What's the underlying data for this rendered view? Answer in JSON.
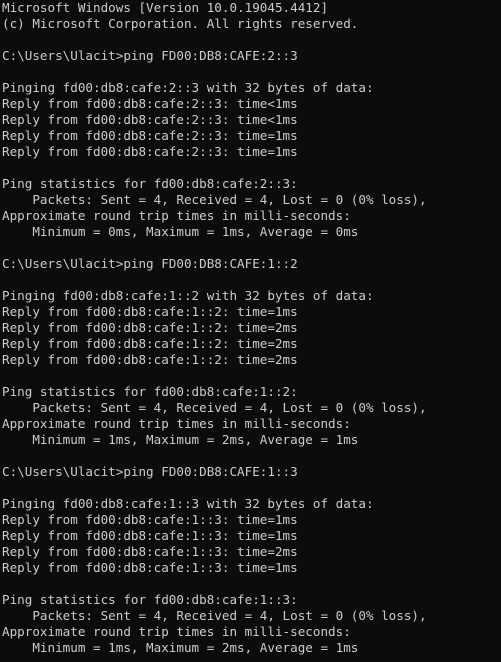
{
  "theme": {
    "background": "#0c0c0c",
    "foreground": "#cccccc"
  },
  "console": {
    "lines": [
      "Microsoft Windows [Version 10.0.19045.4412]",
      "(c) Microsoft Corporation. All rights reserved.",
      "",
      "C:\\Users\\Ulacit>ping FD00:DB8:CAFE:2::3",
      "",
      "Pinging fd00:db8:cafe:2::3 with 32 bytes of data:",
      "Reply from fd00:db8:cafe:2::3: time<1ms",
      "Reply from fd00:db8:cafe:2::3: time<1ms",
      "Reply from fd00:db8:cafe:2::3: time=1ms",
      "Reply from fd00:db8:cafe:2::3: time=1ms",
      "",
      "Ping statistics for fd00:db8:cafe:2::3:",
      "    Packets: Sent = 4, Received = 4, Lost = 0 (0% loss),",
      "Approximate round trip times in milli-seconds:",
      "    Minimum = 0ms, Maximum = 1ms, Average = 0ms",
      "",
      "C:\\Users\\Ulacit>ping FD00:DB8:CAFE:1::2",
      "",
      "Pinging fd00:db8:cafe:1::2 with 32 bytes of data:",
      "Reply from fd00:db8:cafe:1::2: time=1ms",
      "Reply from fd00:db8:cafe:1::2: time=2ms",
      "Reply from fd00:db8:cafe:1::2: time=2ms",
      "Reply from fd00:db8:cafe:1::2: time=2ms",
      "",
      "Ping statistics for fd00:db8:cafe:1::2:",
      "    Packets: Sent = 4, Received = 4, Lost = 0 (0% loss),",
      "Approximate round trip times in milli-seconds:",
      "    Minimum = 1ms, Maximum = 2ms, Average = 1ms",
      "",
      "C:\\Users\\Ulacit>ping FD00:DB8:CAFE:1::3",
      "",
      "Pinging fd00:db8:cafe:1::3 with 32 bytes of data:",
      "Reply from fd00:db8:cafe:1::3: time=1ms",
      "Reply from fd00:db8:cafe:1::3: time=1ms",
      "Reply from fd00:db8:cafe:1::3: time=2ms",
      "Reply from fd00:db8:cafe:1::3: time=1ms",
      "",
      "Ping statistics for fd00:db8:cafe:1::3:",
      "    Packets: Sent = 4, Received = 4, Lost = 0 (0% loss),",
      "Approximate round trip times in milli-seconds:",
      "    Minimum = 1ms, Maximum = 2ms, Average = 1ms"
    ]
  }
}
